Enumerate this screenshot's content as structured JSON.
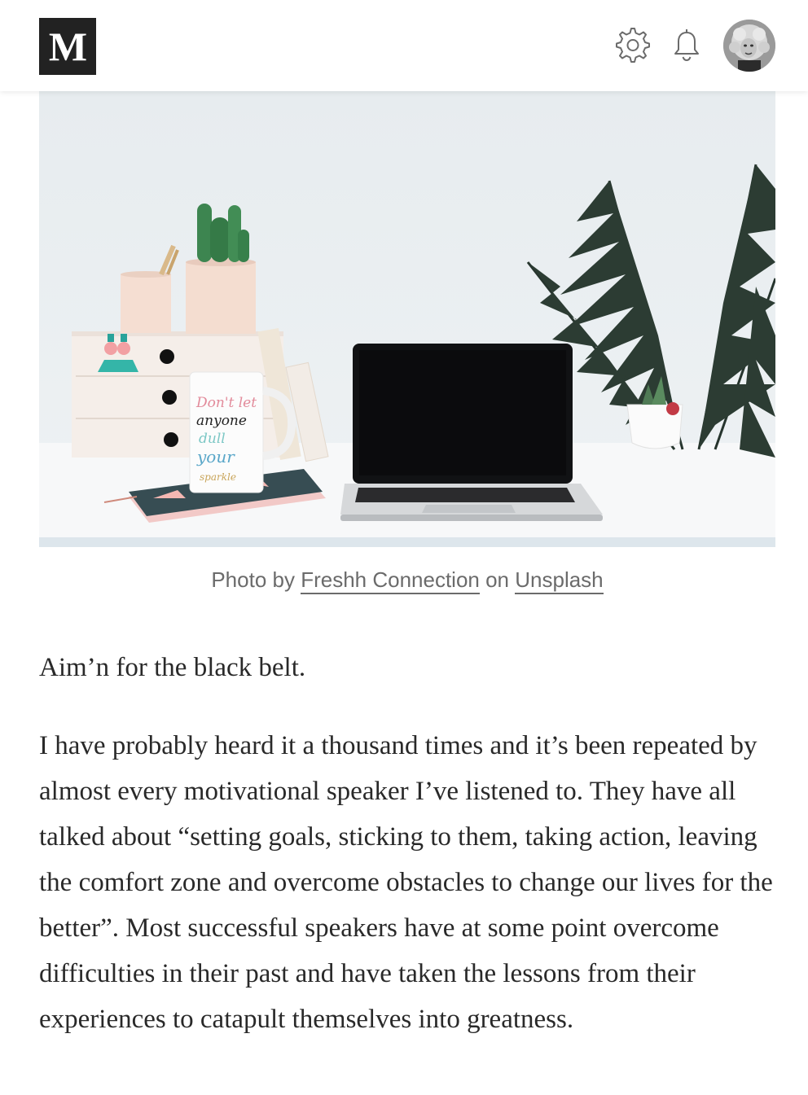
{
  "header": {
    "logo_text": "M",
    "icons": [
      "gear-icon",
      "bell-icon"
    ],
    "colors": {
      "logo_bg": "#222222",
      "page_bg": "#ffffff"
    }
  },
  "hero": {
    "mug_text": [
      "Don't let",
      "anyone",
      "dull",
      "your",
      "sparkle"
    ]
  },
  "caption": {
    "prefix": "Photo by ",
    "author_link": "Freshh Connection",
    "middle": " on ",
    "source_link": "Unsplash"
  },
  "article": {
    "paragraphs": [
      "Aim’n for the black belt.",
      "I have probably heard it a thousand times and it’s been repeated by almost every motivational speaker I’ve listened to. They have all talked about “setting goals, sticking to them, taking action, leaving the comfort zone and overcome obstacles to change our lives for the better”. Most successful speakers have at some point overcome difficulties in their past and have taken the lessons from their experiences to catapult themselves into greatness."
    ]
  }
}
